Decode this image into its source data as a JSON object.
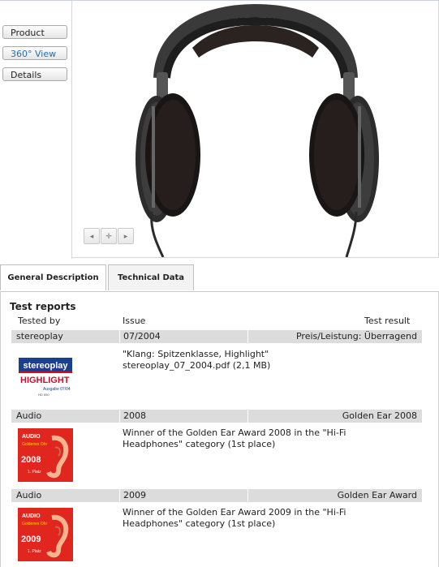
{
  "nav": {
    "product": "Product",
    "view360": "360° View",
    "details": "Details"
  },
  "viewer_controls": {
    "prev": "◂",
    "zoom": "✛",
    "next": "▸"
  },
  "tabs": [
    "General Description",
    "Technical Data"
  ],
  "section_title": "Test reports",
  "columns": {
    "tested_by": "Tested by",
    "issue": "Issue",
    "result": "Test result"
  },
  "reports": [
    {
      "tested_by": "stereoplay",
      "issue": "07/2004",
      "result": "Preis/Leistung: Überragend",
      "desc1": "\"Klang: Spitzenklasse, Highlight\"",
      "desc2": "stereoplay_07_2004.pdf (2,1 MB)"
    },
    {
      "tested_by": "Audio",
      "issue": "2008",
      "result": "Golden Ear 2008",
      "desc1": "Winner of the Golden Ear Award 2008 in the \"Hi-Fi",
      "desc2": "Headphones\" category (1st place)"
    },
    {
      "tested_by": "Audio",
      "issue": "2009",
      "result": "Golden Ear Award",
      "desc1": "Winner of the Golden Ear Award 2009 in the \"Hi-Fi",
      "desc2": "Headphones\" category (1st place)"
    }
  ],
  "logos": {
    "stereoplay": {
      "title": "stereoplay",
      "highlight": "HIGHLIGHT",
      "issue": "Ausgabe 07/04",
      "model": "HD 650"
    },
    "audio2008": {
      "brand": "AUDIO",
      "label": "Goldenes Ohr",
      "year": "2008",
      "place": "1. Platz"
    },
    "audio2009": {
      "brand": "AUDIO",
      "label": "Goldenes Ohr",
      "year": "2009",
      "place": "1. Platz"
    }
  },
  "colors": {
    "link": "#1f6fb8",
    "row_bg": "#dcdcdc",
    "award_red": "#e0261f",
    "stereoplay_blue": "#1a3f8c"
  }
}
